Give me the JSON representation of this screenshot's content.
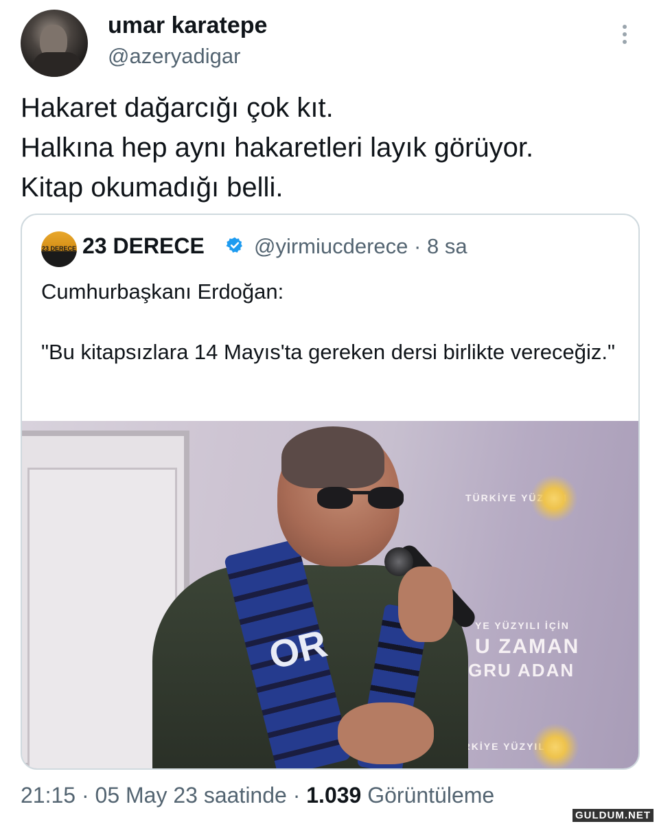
{
  "author": {
    "name": "umar karatepe",
    "handle": "@azeryadigar"
  },
  "tweet": {
    "lines": [
      "Hakaret dağarcığı çok kıt.",
      "Halkına hep aynı hakaretleri layık görüyor.",
      "Kitap okumadığı belli."
    ]
  },
  "quoted": {
    "avatar_text": "23 DERECE",
    "name": "23 DERECE",
    "meta": "@yirmiucderece · 8 sa",
    "text_line1": "Cumhurbaşkanı Erdoğan:",
    "text_line2": "\"Bu kitapsızlara 14 Mayıs'ta gereken dersi birlikte vereceğiz.\"",
    "photo": {
      "banner_texts": [
        "TÜRKİYE YÜZYILI",
        "YE YÜZYILI İÇİN",
        "U ZAMAN",
        "GRU ADAN",
        "TÜRKİYE YÜZYILI"
      ],
      "scarf_text": "OR"
    }
  },
  "footer": {
    "time": "21:15 · 05 May 23 saatinde · ",
    "views_count": "1.039",
    "views_label": " Görüntüleme"
  },
  "watermark": "GULDUM.NET",
  "colors": {
    "text": "#0f1419",
    "muted": "#536471",
    "border": "#cfd9de",
    "verified": "#1d9bf0"
  },
  "icons": [
    "more-vertical-icon",
    "verified-badge-icon"
  ]
}
